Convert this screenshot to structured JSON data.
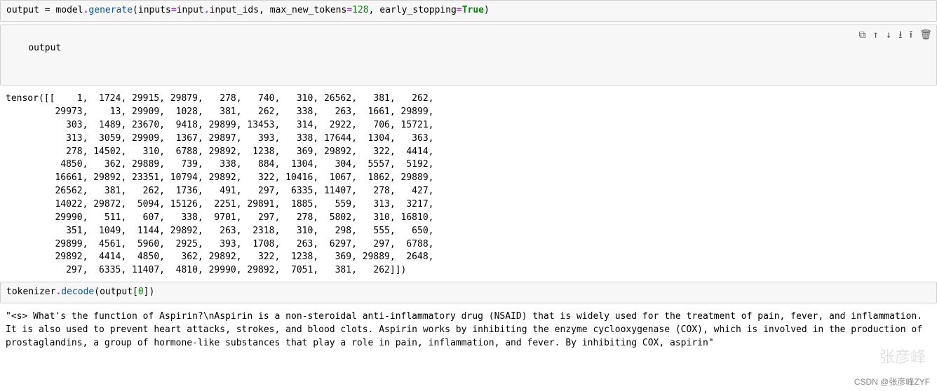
{
  "cells": {
    "code1": {
      "v_output": "output",
      "op_eq": " = ",
      "v_model": "model",
      "dot1": ".",
      "fn_generate": "generate",
      "lp": "(",
      "p_inputs": "inputs",
      "op_eq2": "=",
      "v_input": "input",
      "dot2": ".",
      "v_input_ids": "input_ids",
      "c1": ", ",
      "p_maxnew": "max_new_tokens",
      "op_eq3": "=",
      "n_128": "128",
      "c2": ", ",
      "p_early": "early_stopping",
      "op_eq4": "=",
      "kw_true": "True",
      "rp": ")"
    },
    "code2": "output",
    "toolbar_icons": {
      "copy": "⧉",
      "up": "↑",
      "down": "↓",
      "download": "⭳",
      "upload": "⭱",
      "delete": "🗑"
    },
    "tensor_output": "tensor([[    1,  1724, 29915, 29879,   278,   740,   310, 26562,   381,   262,\n         29973,    13, 29909,  1028,   381,   262,   338,   263,  1661, 29899,\n           303,  1489, 23670,  9418, 29899, 13453,   314,  2922,   706, 15721,\n           313,  3059, 29909,  1367, 29897,   393,   338, 17644,  1304,   363,\n           278, 14502,   310,  6788, 29892,  1238,   369, 29892,   322,  4414,\n          4850,   362, 29889,   739,   338,   884,  1304,   304,  5557,  5192,\n         16661, 29892, 23351, 10794, 29892,   322, 10416,  1067,  1862, 29889,\n         26562,   381,   262,  1736,   491,   297,  6335, 11407,   278,   427,\n         14022, 29872,  5094, 15126,  2251, 29891,  1885,   559,   313,  3217,\n         29990,   511,   607,   338,  9701,   297,   278,  5802,   310, 16810,\n           351,  1049,  1144, 29892,   263,  2318,   310,   298,   555,   650,\n         29899,  4561,  5960,  2925,   393,  1708,   263,  6297,   297,  6788,\n         29892,  4414,  4850,   362, 29892,   322,  1238,   369, 29889,  2648,\n           297,  6335, 11407,  4810, 29990, 29892,  7051,   381,   262]])",
    "code3": {
      "v_tokenizer": "tokenizer",
      "dot": ".",
      "fn_decode": "decode",
      "lp": "(",
      "v_output": "output",
      "lb": "[",
      "idx": "0",
      "rb": "]",
      "rp": ")"
    },
    "decode_output": "\"<s> What's the function of Aspirin?\\nAspirin is a non-steroidal anti-inflammatory drug (NSAID) that is widely used for the treatment of pain, fever, and inflammation. It is also used to prevent heart attacks, strokes, and blood clots. Aspirin works by inhibiting the enzyme cyclooxygenase (COX), which is involved in the production of prostaglandins, a group of hormone-like substances that play a role in pain, inflammation, and fever. By inhibiting COX, aspirin\""
  },
  "watermark": "张彦峰",
  "credit": "CSDN @张彦峰ZYF"
}
